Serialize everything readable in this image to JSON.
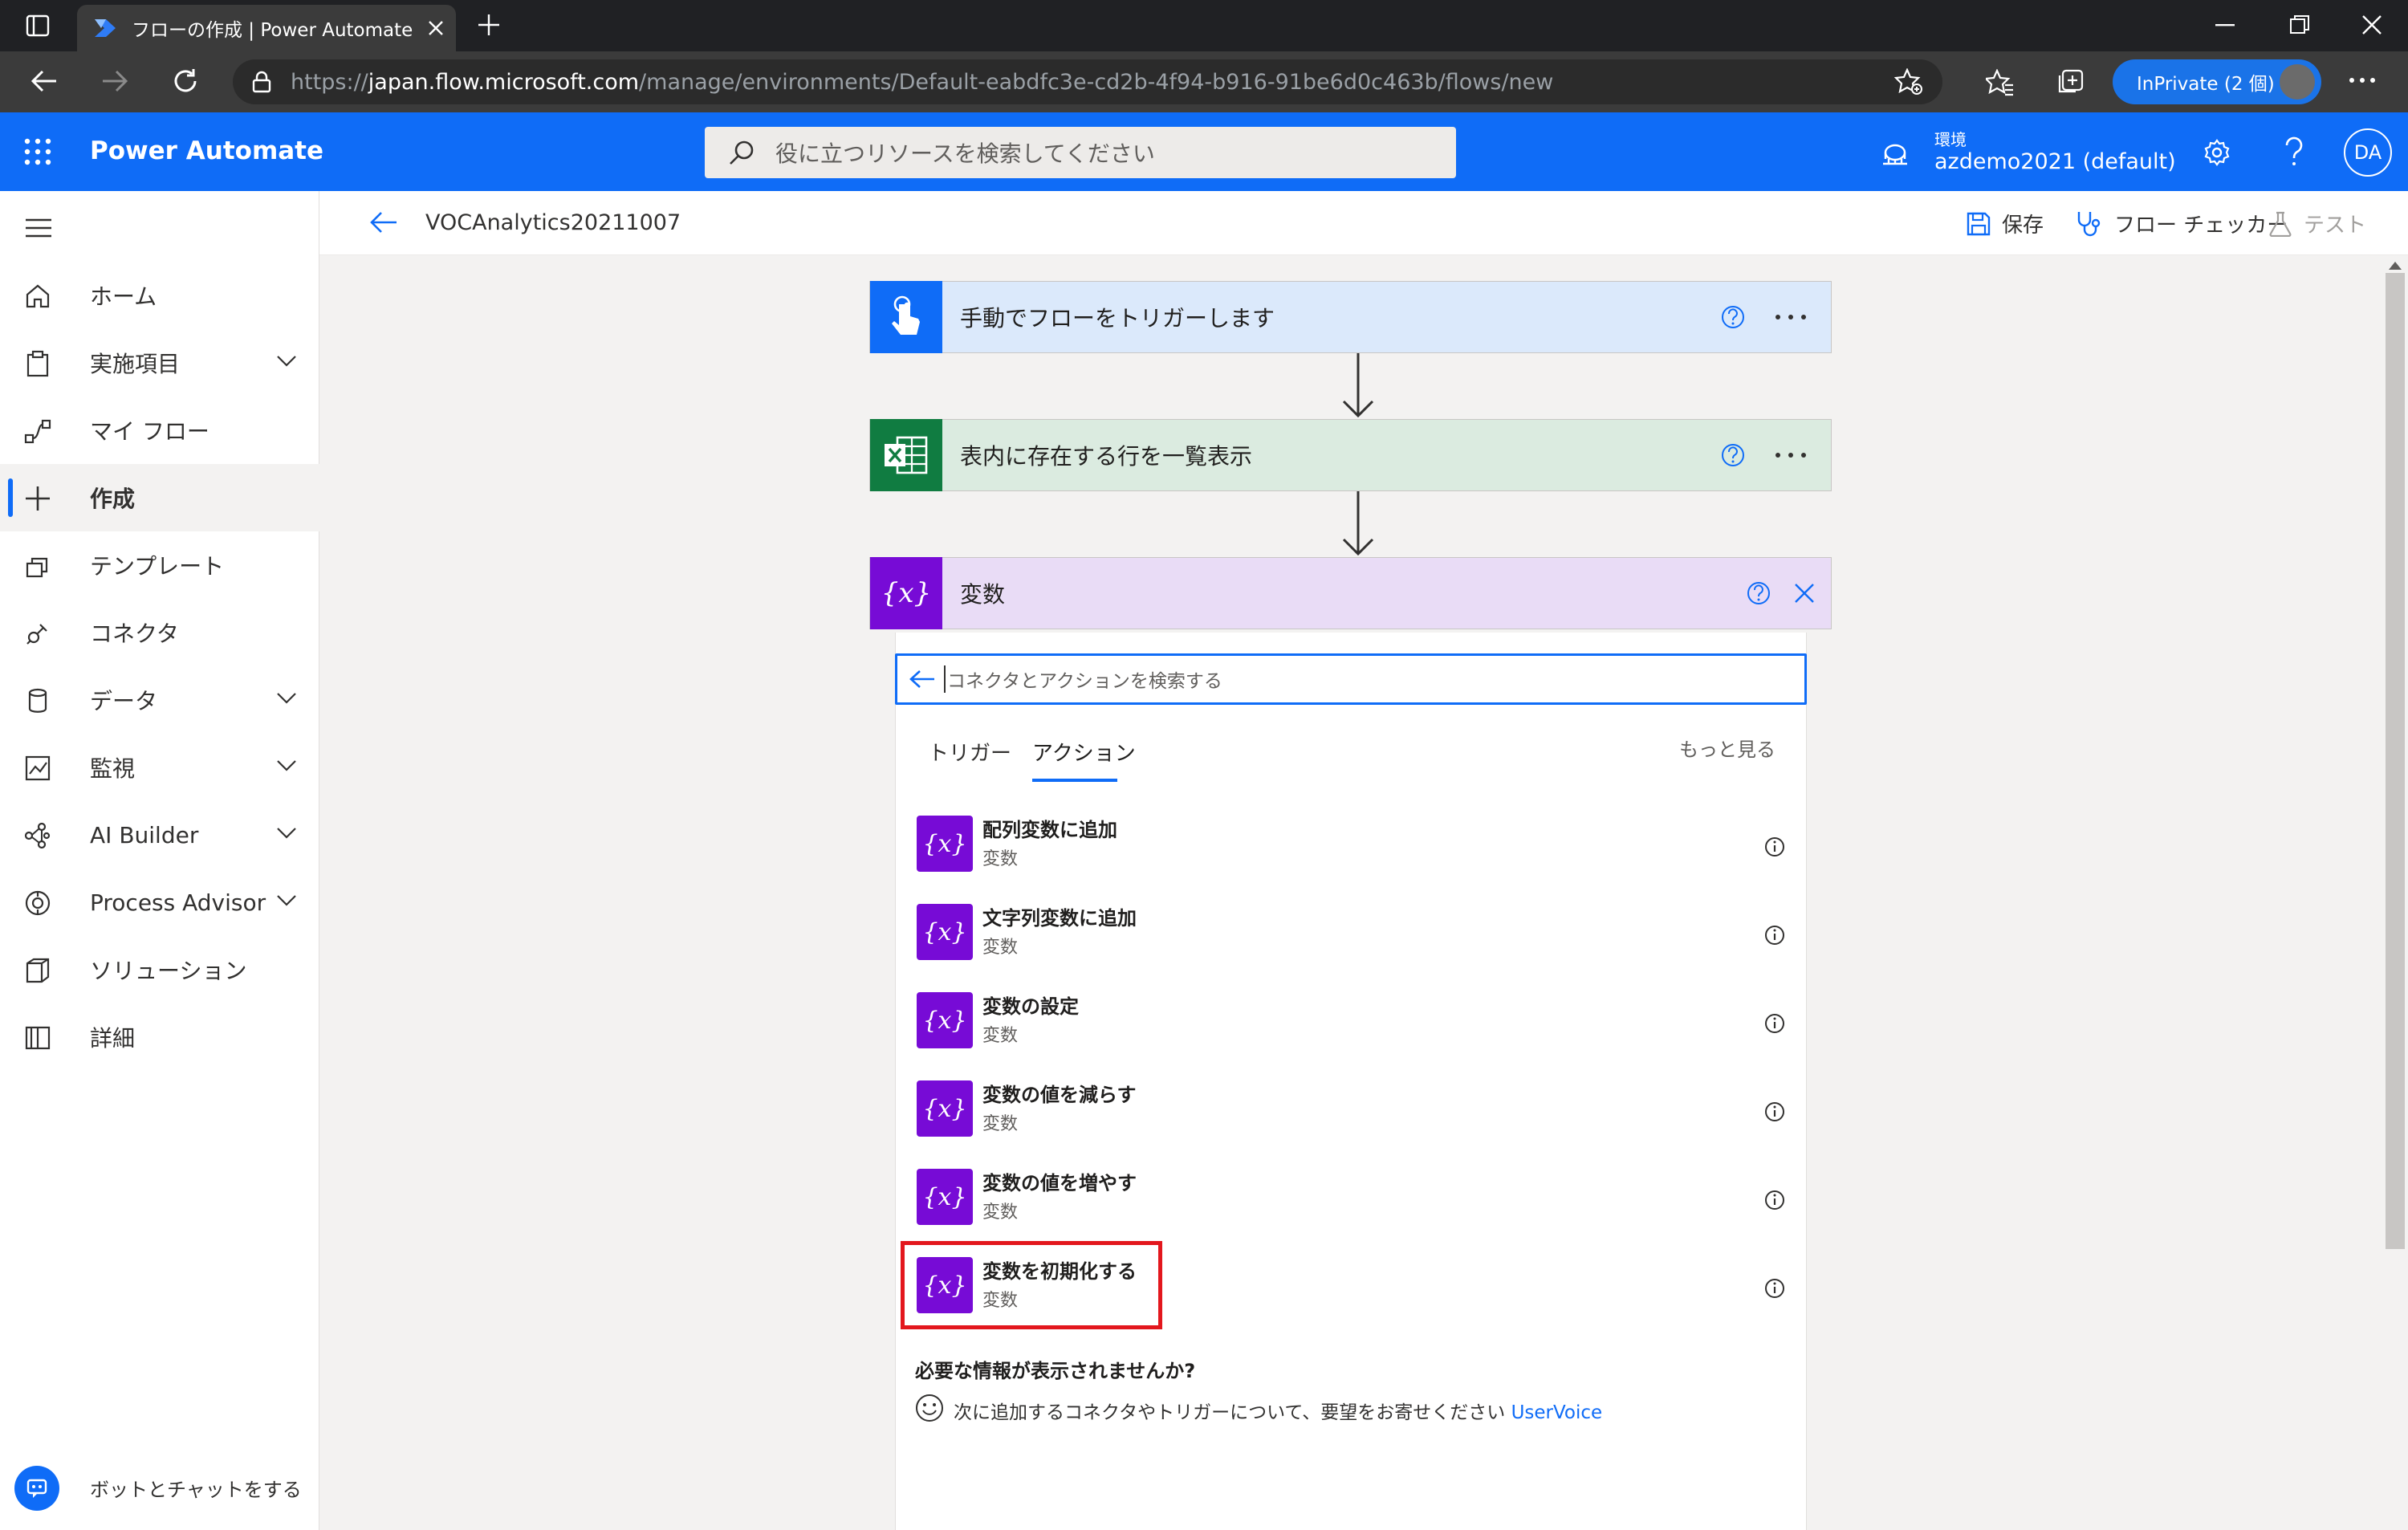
{
  "browser": {
    "tab_title": "フローの作成 | Power Automate",
    "url_prefix": "https://",
    "url_host": "japan.flow.microsoft.com",
    "url_path": "/manage/environments/Default-eabdfc3e-cd2b-4f94-b916-91be6d0c463b/flows/new",
    "inprivate_label": "InPrivate (2 個)"
  },
  "header": {
    "brand": "Power Automate",
    "search_placeholder": "役に立つリソースを検索してください",
    "env_label": "環境",
    "env_value": "azdemo2021 (default)",
    "user_initials": "DA"
  },
  "sidebar": {
    "items": [
      {
        "label": "ホーム",
        "icon": "home-icon"
      },
      {
        "label": "実施項目",
        "icon": "clipboard-icon",
        "expandable": true
      },
      {
        "label": "マイ フロー",
        "icon": "flow-icon"
      },
      {
        "label": "作成",
        "icon": "plus-icon",
        "active": true
      },
      {
        "label": "テンプレート",
        "icon": "template-icon"
      },
      {
        "label": "コネクタ",
        "icon": "connector-icon"
      },
      {
        "label": "データ",
        "icon": "database-icon",
        "expandable": true
      },
      {
        "label": "監視",
        "icon": "monitor-icon",
        "expandable": true
      },
      {
        "label": "AI Builder",
        "icon": "ai-builder-icon",
        "expandable": true
      },
      {
        "label": "Process Advisor",
        "icon": "process-advisor-icon",
        "expandable": true
      },
      {
        "label": "ソリューション",
        "icon": "solution-icon"
      },
      {
        "label": "詳細",
        "icon": "book-icon"
      }
    ],
    "chatbot_label": "ボットとチャットをする"
  },
  "flow": {
    "name": "VOCAnalytics20211007",
    "commands": {
      "save": "保存",
      "checker": "フロー チェッカー",
      "test": "テスト"
    },
    "steps": [
      {
        "title": "手動でフローをトリガーします",
        "color": "#0f6cf7",
        "bg": "#dbe9fb"
      },
      {
        "title": "表内に存在する行を一覧表示",
        "color": "#107c41",
        "bg": "#dbebe0"
      },
      {
        "title": "変数",
        "color": "#770bd6",
        "bg": "#e9dcf6"
      }
    ]
  },
  "operation_picker": {
    "search_placeholder": "コネクタとアクションを検索する",
    "tabs": {
      "triggers": "トリガー",
      "actions": "アクション",
      "more": "もっと見る"
    },
    "actions": [
      {
        "name": "配列変数に追加",
        "connector": "変数"
      },
      {
        "name": "文字列変数に追加",
        "connector": "変数"
      },
      {
        "name": "変数の設定",
        "connector": "変数"
      },
      {
        "name": "変数の値を減らす",
        "connector": "変数"
      },
      {
        "name": "変数の値を増やす",
        "connector": "変数"
      },
      {
        "name": "変数を初期化する",
        "connector": "変数",
        "highlighted": true
      }
    ],
    "feedback_title": "必要な情報が表示されませんか?",
    "feedback_text": "次に追加するコネクタやトリガーについて、要望をお寄せください",
    "feedback_link": "UserVoice"
  },
  "colors": {
    "accent": "#0f6cf7",
    "variable": "#770bd6",
    "highlight": "#e3171d"
  }
}
